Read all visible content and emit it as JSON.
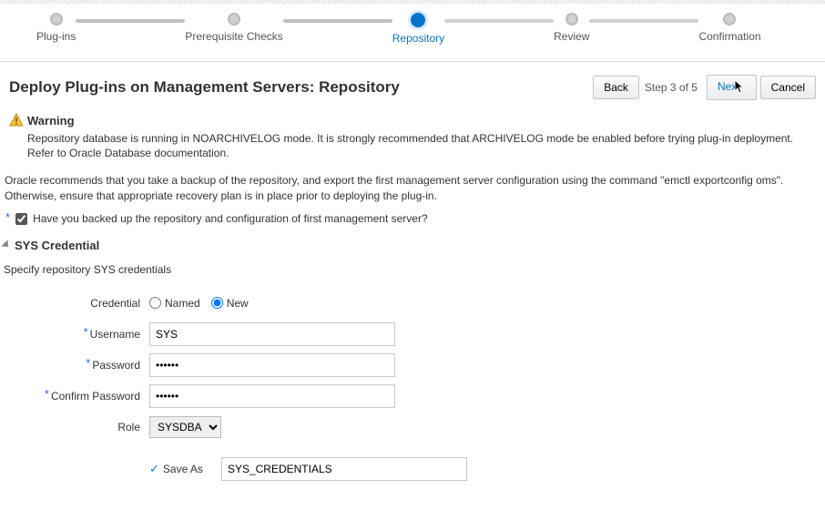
{
  "train": {
    "steps": [
      "Plug-ins",
      "Prerequisite Checks",
      "Repository",
      "Review",
      "Confirmation"
    ],
    "current_index": 2
  },
  "header": {
    "title": "Deploy Plug-ins on Management Servers: Repository",
    "back": "Back",
    "step_indicator": "Step 3 of 5",
    "next": "Next",
    "cancel": "Cancel"
  },
  "warning": {
    "heading": "Warning",
    "text": "Repository database is running in NOARCHIVELOG mode. It is strongly recommended that ARCHIVELOG mode be enabled before trying plug-in deployment. Refer to Oracle Database documentation."
  },
  "recommend_text": "Oracle recommends that you take a backup of the repository, and export the first management server configuration using the command \"emctl exportconfig oms\". Otherwise, ensure that appropriate recovery plan is in place prior to deploying the plug-in.",
  "backup_checkbox": {
    "label": "Have you backed up the repository and configuration of first management server?",
    "checked": true
  },
  "sys_section": {
    "heading": "SYS Credential",
    "subtext": "Specify repository SYS credentials"
  },
  "form": {
    "credential_label": "Credential",
    "credential_named": "Named",
    "credential_new": "New",
    "credential_selected": "new",
    "username_label": "Username",
    "username_value": "SYS",
    "password_label": "Password",
    "password_value": "••••••",
    "confirm_label": "Confirm Password",
    "confirm_value": "••••••",
    "role_label": "Role",
    "role_value": "SYSDBA",
    "saveas_label": "Save As",
    "saveas_value": "SYS_CREDENTIALS",
    "saveas_checked": true
  }
}
